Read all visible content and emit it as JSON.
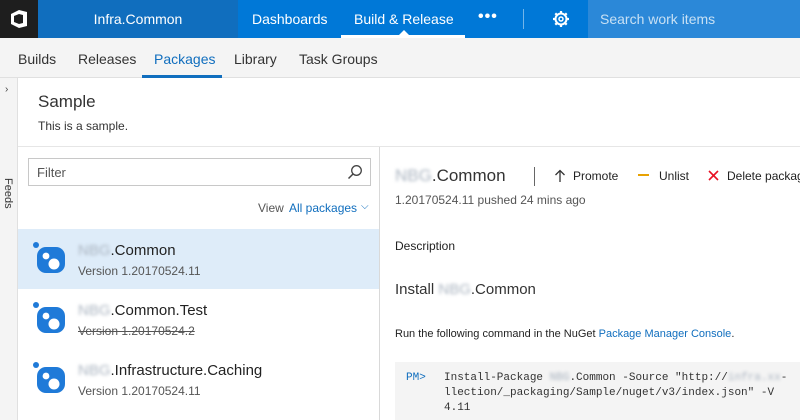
{
  "topbar": {
    "account": "Infra.Common",
    "nav_dashboards": "Dashboards",
    "nav_build_release": "Build & Release",
    "more": "•••",
    "search_placeholder": "Search work items"
  },
  "subnav": {
    "tabs": [
      "Builds",
      "Releases",
      "Packages",
      "Library",
      "Task Groups"
    ],
    "active": "Packages"
  },
  "feeds_label": "Feeds",
  "feed": {
    "title": "Sample",
    "description": "This is a sample."
  },
  "filter": {
    "placeholder": "Filter"
  },
  "view": {
    "label": "View",
    "value": "All packages"
  },
  "packages": [
    {
      "name_prefix": "NBG",
      "name_suffix": ".Common",
      "version": "Version 1.20170524.11",
      "struck": false
    },
    {
      "name_prefix": "NBG",
      "name_suffix": ".Common.Test",
      "version": "Version 1.20170524.2",
      "struck": true
    },
    {
      "name_prefix": "NBG",
      "name_suffix": ".Infrastructure.Caching",
      "version": "Version 1.20170524.11",
      "struck": false
    }
  ],
  "detail": {
    "title_prefix": "NBG",
    "title_suffix": ".Common",
    "actions": {
      "promote": "Promote",
      "unlist": "Unlist",
      "delete": "Delete package"
    },
    "pushed": "1.20170524.11 pushed 24 mins ago",
    "description_heading": "Description",
    "install_prefix": "Install ",
    "install_blur": "NBG",
    "install_suffix": ".Common",
    "run_text": "Run the following command in the NuGet ",
    "run_link": "Package Manager Console",
    "run_end": ".",
    "code": {
      "prompt": "PM>",
      "line1_a": "Install-Package ",
      "line1_blur": "NBG",
      "line1_b": ".Common -Source \"http://",
      "line1_blur2": "infra.xx",
      "line1_c": "-",
      "line2": "llection/_packaging/Sample/nuget/v3/index.json\" -V",
      "line3": "4.11"
    }
  },
  "colors": {
    "accent": "#0078d7",
    "link": "#106ebe",
    "selected_row": "#deecf9",
    "unlist": "#e8a202",
    "delete": "#e81123"
  }
}
